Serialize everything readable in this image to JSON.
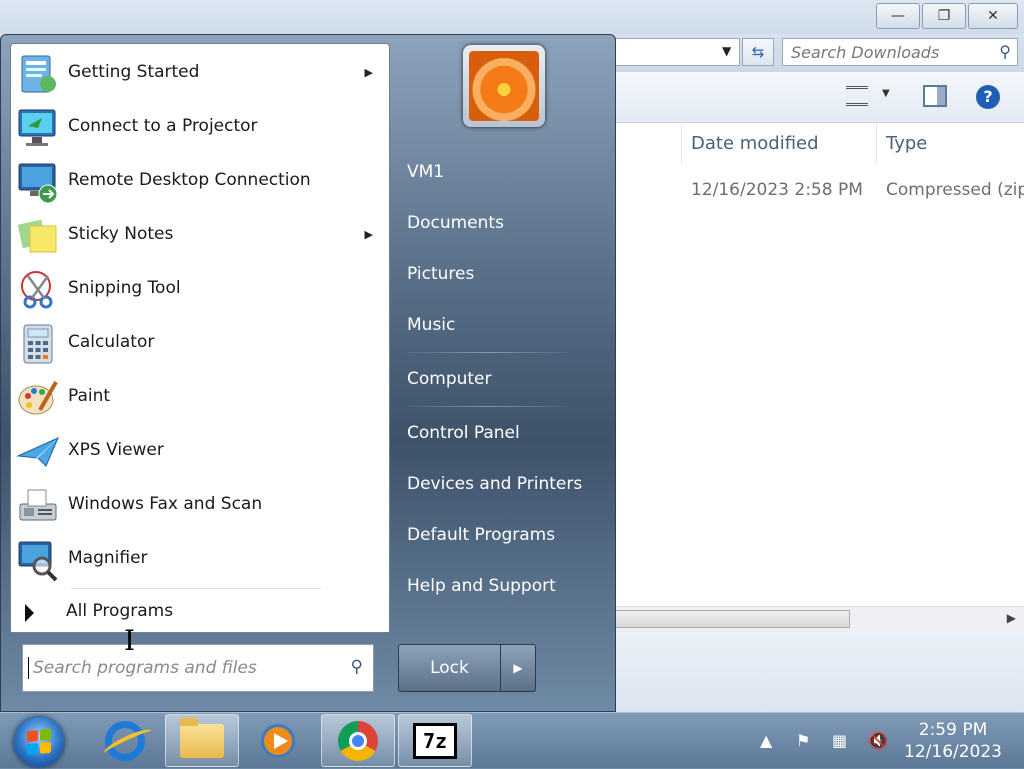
{
  "explorer": {
    "search_placeholder": "Search Downloads",
    "columns": [
      "Date modified",
      "Type"
    ],
    "row": {
      "date": "12/16/2023 2:58 PM",
      "type": "Compressed (zipp"
    }
  },
  "start_menu": {
    "programs": [
      {
        "label": "Getting Started",
        "icon": "getting-started-icon",
        "has_submenu": true
      },
      {
        "label": "Connect to a Projector",
        "icon": "projector-icon",
        "has_submenu": false
      },
      {
        "label": "Remote Desktop Connection",
        "icon": "remote-desktop-icon",
        "has_submenu": false
      },
      {
        "label": "Sticky Notes",
        "icon": "sticky-notes-icon",
        "has_submenu": true
      },
      {
        "label": "Snipping Tool",
        "icon": "snipping-tool-icon",
        "has_submenu": false
      },
      {
        "label": "Calculator",
        "icon": "calculator-icon",
        "has_submenu": false
      },
      {
        "label": "Paint",
        "icon": "paint-icon",
        "has_submenu": false
      },
      {
        "label": "XPS Viewer",
        "icon": "xps-viewer-icon",
        "has_submenu": false
      },
      {
        "label": "Windows Fax and Scan",
        "icon": "fax-scan-icon",
        "has_submenu": false
      },
      {
        "label": "Magnifier",
        "icon": "magnifier-icon",
        "has_submenu": false
      }
    ],
    "all_programs": "All Programs",
    "search_placeholder": "Search programs and files",
    "right_links": [
      "VM1",
      "Documents",
      "Pictures",
      "Music",
      "Computer",
      "Control Panel",
      "Devices and Printers",
      "Default Programs",
      "Help and Support"
    ],
    "lock_label": "Lock"
  },
  "taskbar": {
    "time": "2:59 PM",
    "date": "12/16/2023",
    "apps": [
      "internet-explorer-icon",
      "windows-explorer-icon",
      "media-player-icon",
      "chrome-icon",
      "7zip-icon"
    ],
    "seven_zip_text": "7z"
  }
}
